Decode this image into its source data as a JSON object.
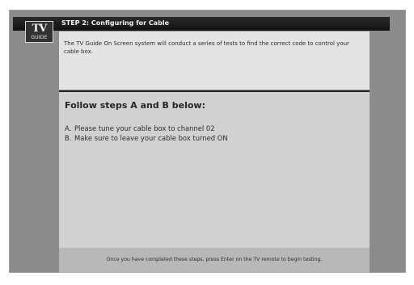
{
  "header": {
    "logo_top": "TV",
    "logo_bottom": "GUIDE",
    "step_title": "STEP 2: Configuring for Cable"
  },
  "description": {
    "text": "The TV Guide On Screen system will conduct a series of tests to find the correct code to control your cable box."
  },
  "main": {
    "heading": "Follow steps A and B below:",
    "steps": [
      {
        "letter": "A.",
        "text": "Please tune your cable box to channel 02"
      },
      {
        "letter": "B.",
        "text": "Make sure to leave your cable box turned ON"
      }
    ]
  },
  "footer": {
    "text": "Once you have completed these steps, press Enter on the TV remote to begin testing."
  }
}
